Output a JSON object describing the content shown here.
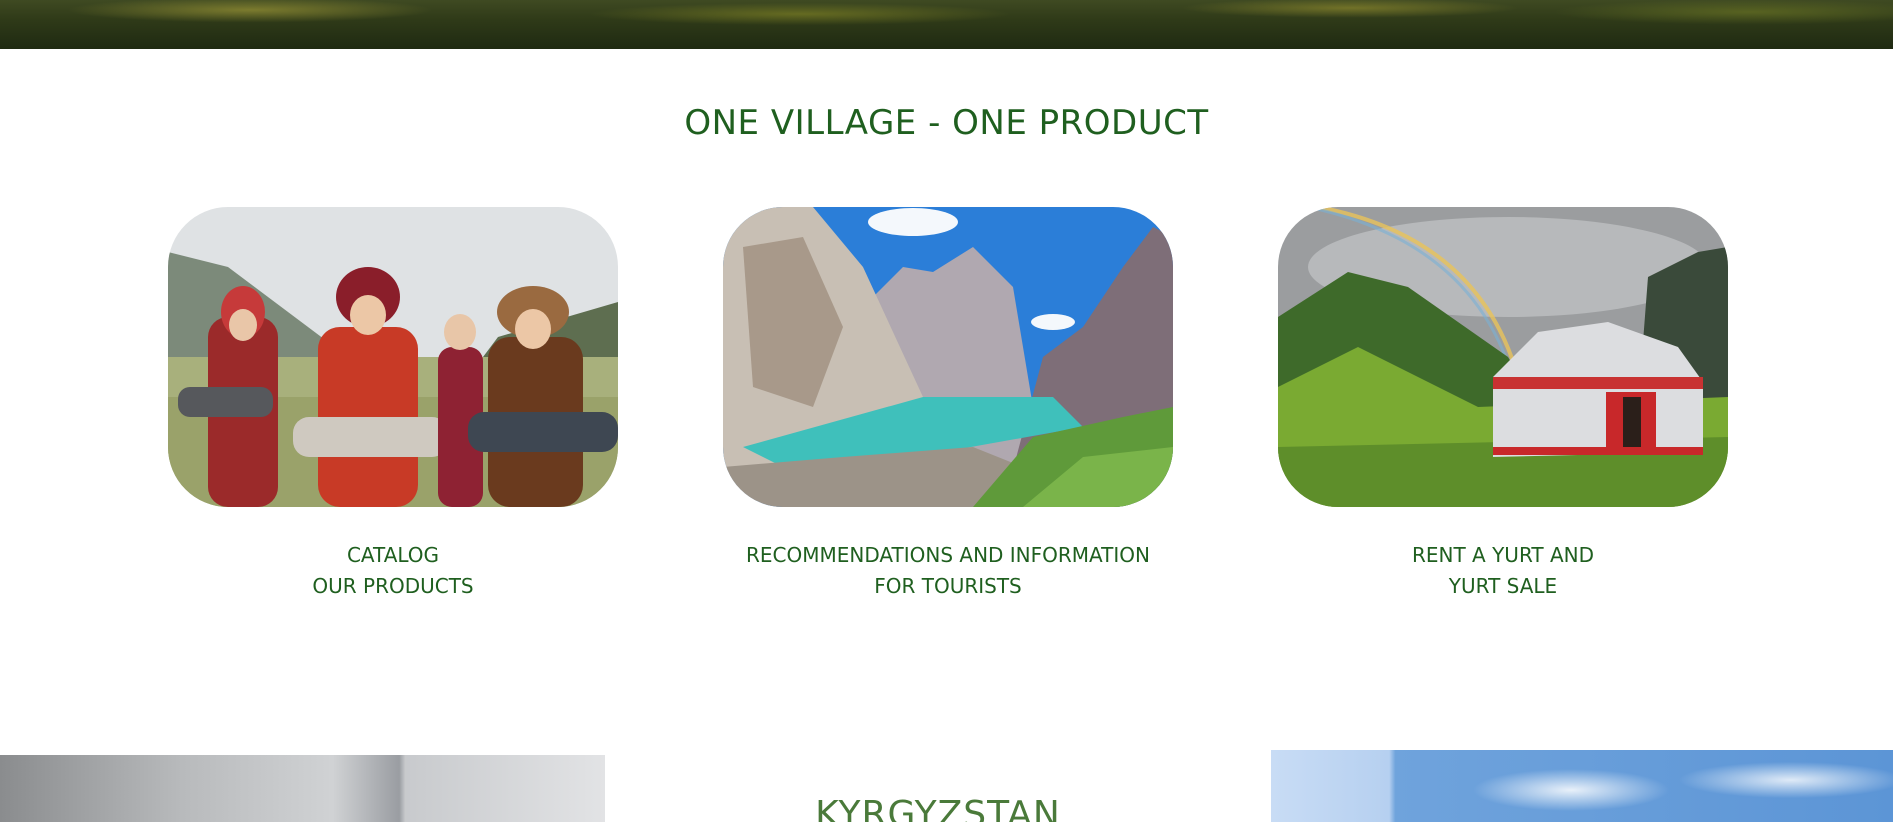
{
  "section": {
    "title": "ONE VILLAGE - ONE PRODUCT"
  },
  "cards": [
    {
      "line1": "CATALOG",
      "line2": "OUR PRODUCTS",
      "image": "women-in-traditional-dress-photo"
    },
    {
      "line1": "RECOMMENDATIONS AND INFORMATION",
      "line2": "FOR TOURISTS",
      "image": "mountain-lake-photo"
    },
    {
      "line1": "RENT A YURT AND",
      "line2": "YURT SALE",
      "image": "yurt-rainbow-photo"
    }
  ],
  "next_section": {
    "title": "KYRGYZSTAN"
  },
  "colors": {
    "accent_green": "#1f5f1f",
    "secondary_green": "#4a7a3a",
    "background": "#ffffff"
  }
}
